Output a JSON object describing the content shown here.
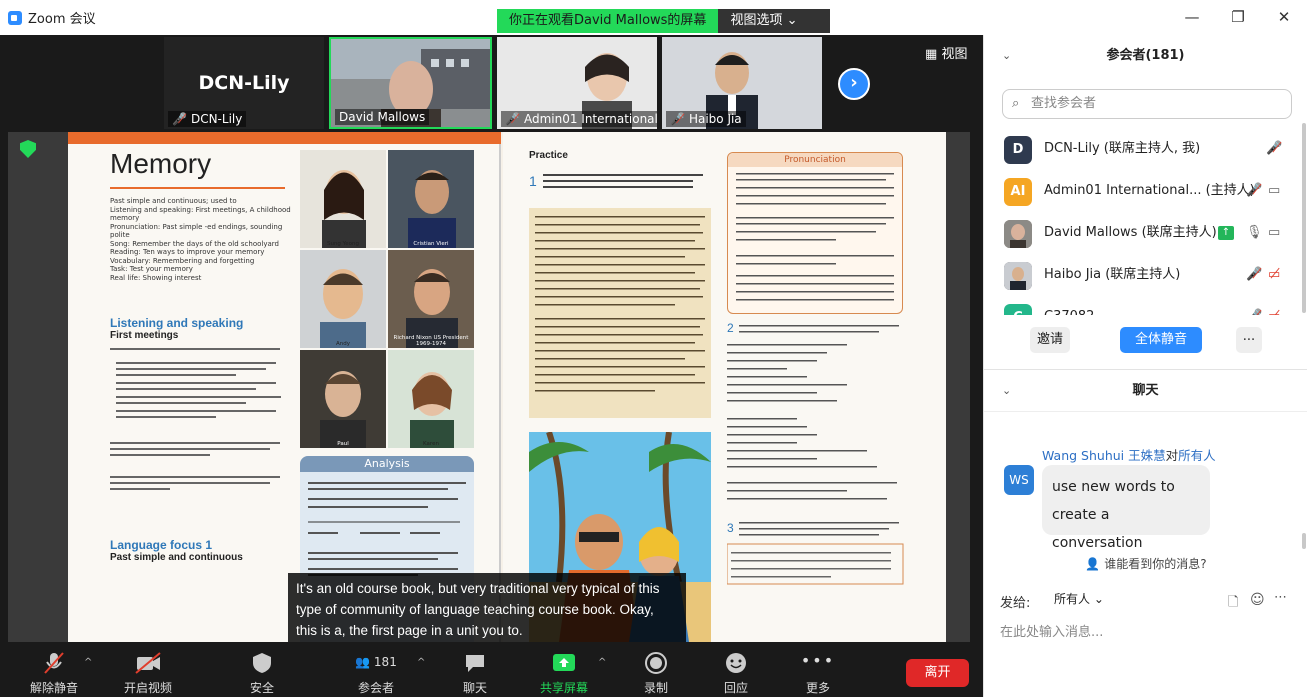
{
  "titlebar": {
    "app_title": "Zoom 会议",
    "share_banner": "你正在观看David Mallows的屏幕",
    "view_options": "视图选项 ⌄",
    "minimize": "—",
    "restore": "❐",
    "close": "✕"
  },
  "gallery": {
    "tiles": [
      {
        "name": "DCN-Lily",
        "big_name": "DCN-Lily"
      },
      {
        "name": "David Mallows"
      },
      {
        "name": "Admin01 International..."
      },
      {
        "name": "Haibo Jia"
      }
    ],
    "next": "›",
    "view_label": "视图"
  },
  "book": {
    "left": {
      "title": "Memory",
      "objectives": [
        "Past simple and continuous; used to",
        "Listening and speaking: First meetings, A childhood memory",
        "Pronunciation: Past simple -ed endings, sounding polite",
        "Song: Remember the days of the old schoolyard",
        "Reading: Ten ways to improve your memory",
        "Vocabulary: Remembering and forgetting",
        "Task: Test your memory",
        "Real life: Showing interest"
      ],
      "listening_title": "Listening and speaking",
      "first_meetings": "First meetings",
      "language_focus": "Language focus 1",
      "past_simple_cont": "Past simple and continuous",
      "photo_captions": [
        "Sung Yeong",
        "Cristian Vieri",
        "Andy",
        "Richard Nixon US President 1969-1974",
        "Paul",
        "Karen"
      ],
      "analysis": "Analysis"
    },
    "right": {
      "practice": "Practice",
      "pronunciation": "Pronunciation"
    }
  },
  "caption": "It's an old course book, but very traditional very typical of this type of community of language teaching course book. Okay, this is a, the first page in a unit you to.",
  "toolbar": {
    "unmute": "解除静音",
    "start_video": "开启视频",
    "security": "安全",
    "participants": "参会者",
    "participant_count": "181",
    "chat": "聊天",
    "share_screen": "共享屏幕",
    "record": "录制",
    "reactions": "回应",
    "more": "更多",
    "leave": "离开"
  },
  "participants_panel": {
    "title": "参会者(181)",
    "search_placeholder": "查找参会者",
    "list": [
      {
        "avatar": "D",
        "name": "DCN-Lily (联席主持人, 我)",
        "color": "#2f3a4f"
      },
      {
        "avatar": "AI",
        "name": "Admin01 International... (主持人)",
        "color": "#f5a623"
      },
      {
        "avatar": "",
        "name": "David Mallows (联席主持人)",
        "color": "#7a6a5c"
      },
      {
        "avatar": "",
        "name": "Haibo Jia (联席主持人)",
        "color": "#4a4a55"
      },
      {
        "avatar": "C",
        "name": "C37082",
        "color": "#23b78b"
      }
    ],
    "invite": "邀请",
    "mute_all": "全体静音",
    "more": "..."
  },
  "chat_panel": {
    "title": "聊天",
    "sender": "Wang Shuhui 王姝慧",
    "to_label": "对",
    "recipient": "所有人",
    "avatar": "WS",
    "message_line1": "use new words to",
    "message_line2": "create a conversation",
    "who_can_see": "谁能看到你的消息?",
    "send_to_label": "发给:",
    "send_to_value": "所有人 ⌄",
    "input_placeholder": "在此处输入消息..."
  },
  "colors": {
    "zoom_blue": "#2d8cff",
    "share_green": "#23d959",
    "leave_red": "#e02828",
    "muted_red": "#e03e2d"
  }
}
